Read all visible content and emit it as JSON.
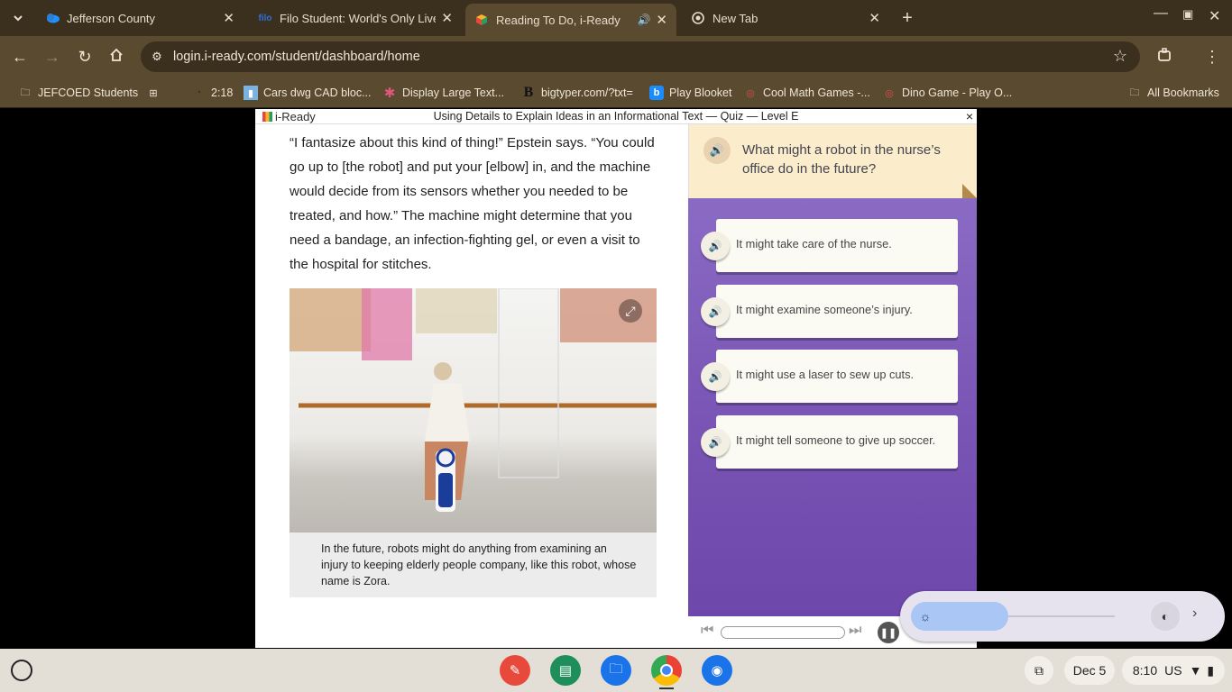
{
  "tabs": [
    {
      "title": "Jefferson County",
      "icon": "onedrive-icon"
    },
    {
      "title": "Filo Student: World's Only Live I",
      "icon": "filo-icon"
    },
    {
      "title": "Reading To Do, i-Ready",
      "icon": "iready-icon",
      "active": true,
      "audio": true
    },
    {
      "title": "New Tab",
      "icon": "chrome-icon"
    }
  ],
  "omnibox": {
    "url": "login.i-ready.com/student/dashboard/home"
  },
  "bookmarks": [
    {
      "label": "JEFCOED Students"
    },
    {
      "label": ""
    },
    {
      "label": "2:18"
    },
    {
      "label": "Cars dwg CAD bloc..."
    },
    {
      "label": "Display Large Text..."
    },
    {
      "label": "bigtyper.com/?txt="
    },
    {
      "label": "Play Blooket"
    },
    {
      "label": "Cool Math Games -..."
    },
    {
      "label": "Dino Game - Play O..."
    },
    {
      "label": "All Bookmarks"
    }
  ],
  "quiz": {
    "brand": "i-Ready",
    "title": "Using Details to Explain Ideas in an Informational Text — Quiz — Level E",
    "close": "×"
  },
  "passage": {
    "text": "“I fantasize about this kind of thing!” Epstein says. “You could go up to [the robot] and put your [elbow] in, and the machine would decide from its sensors whether you needed to be treated, and how.” The machine might determine that you need a bandage, an infection-fighting gel, or even a visit to the hospital for stitches.",
    "caption": "In the future, robots might do anything from examining an injury to keeping elderly people company, like this robot, whose name is Zora."
  },
  "question": {
    "text": "What might a robot in the nurse’s office do in the future?",
    "answers": [
      "It might take care of the nurse.",
      "It might examine someone’s injury.",
      "It might use a laser to sew up cuts.",
      "It might tell someone to give up soccer."
    ]
  },
  "player": {
    "progress": 0
  },
  "brightness": {
    "level": 0.3
  },
  "shelf": {
    "apps": [
      "canvas-icon",
      "classroom-icon",
      "files-icon",
      "chrome-icon",
      "camera-icon"
    ],
    "date": "Dec 5",
    "time": "8:10",
    "locale": "US"
  },
  "colors": {
    "chrome_frame": "#3b2f1e",
    "toolbar": "#5a4a30",
    "question_bg": "#fbeccc",
    "answers_bg": "#7a56b6"
  }
}
